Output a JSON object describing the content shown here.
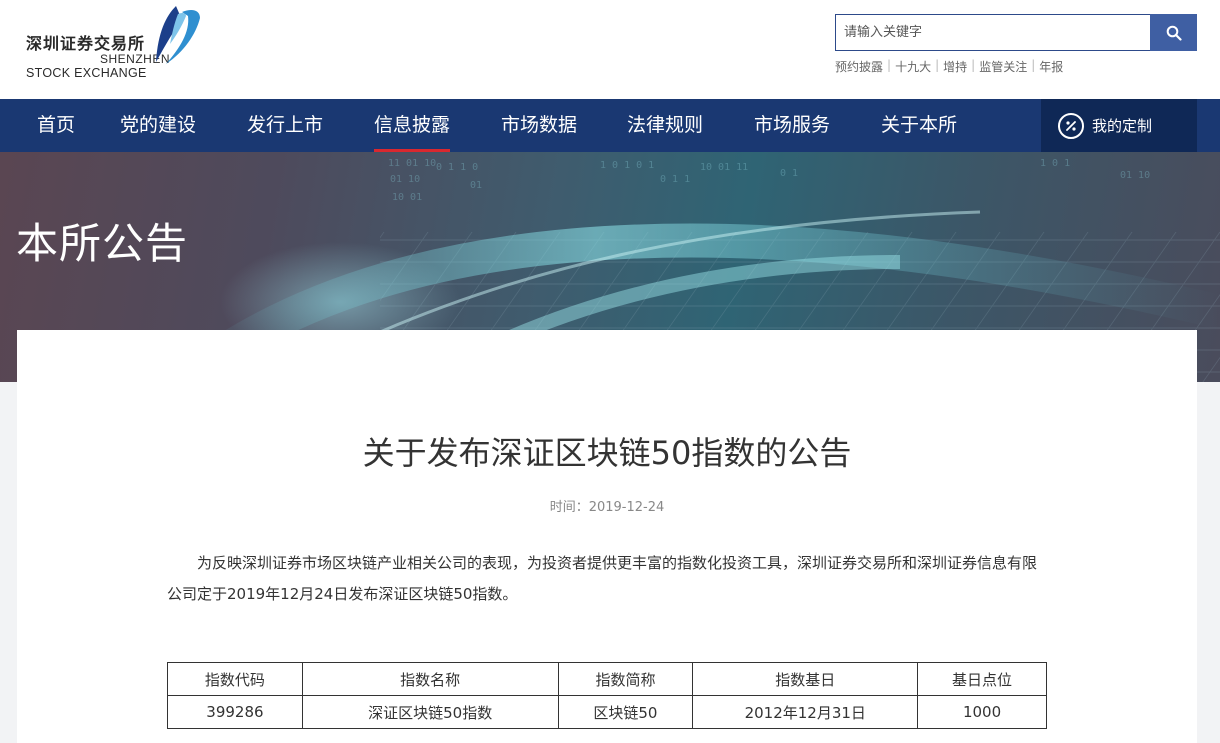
{
  "logo": {
    "cn": "深圳证券交易所",
    "en_line1": "SHENZHEN",
    "en_line2": "STOCK EXCHANGE"
  },
  "search": {
    "placeholder": "请输入关键字",
    "button_icon": "search-icon"
  },
  "hotlinks": [
    "预约披露",
    "十九大",
    "增持",
    "监管关注",
    "年报"
  ],
  "nav": {
    "items": [
      {
        "label": "首页"
      },
      {
        "label": "党的建设"
      },
      {
        "label": "发行上市"
      },
      {
        "label": "信息披露"
      },
      {
        "label": "市场数据"
      },
      {
        "label": "法律规则"
      },
      {
        "label": "市场服务"
      },
      {
        "label": "关于本所"
      }
    ],
    "active": "信息披露",
    "custom_label": "我的定制",
    "custom_icon": "settings-circle-icon"
  },
  "banner": {
    "title": "本所公告"
  },
  "article": {
    "title": "关于发布深证区块链50指数的公告",
    "meta": "时间：2019-12-24",
    "body": "为反映深圳证券市场区块链产业相关公司的表现，为投资者提供更丰富的指数化投资工具，深圳证券交易所和深圳证券信息有限公司定于2019年12月24日发布深证区块链50指数。",
    "table": {
      "headers": [
        "指数代码",
        "指数名称",
        "指数简称",
        "指数基日",
        "基日点位"
      ],
      "rows": [
        [
          "399286",
          "深证区块链50指数",
          "区块链50",
          "2012年12月31日",
          "1000"
        ]
      ]
    }
  },
  "colors": {
    "nav_bg": "#1a3872",
    "nav_active_underline": "#d9282f",
    "search_button": "#3f5fa3",
    "custom_bg": "#0f2856"
  }
}
